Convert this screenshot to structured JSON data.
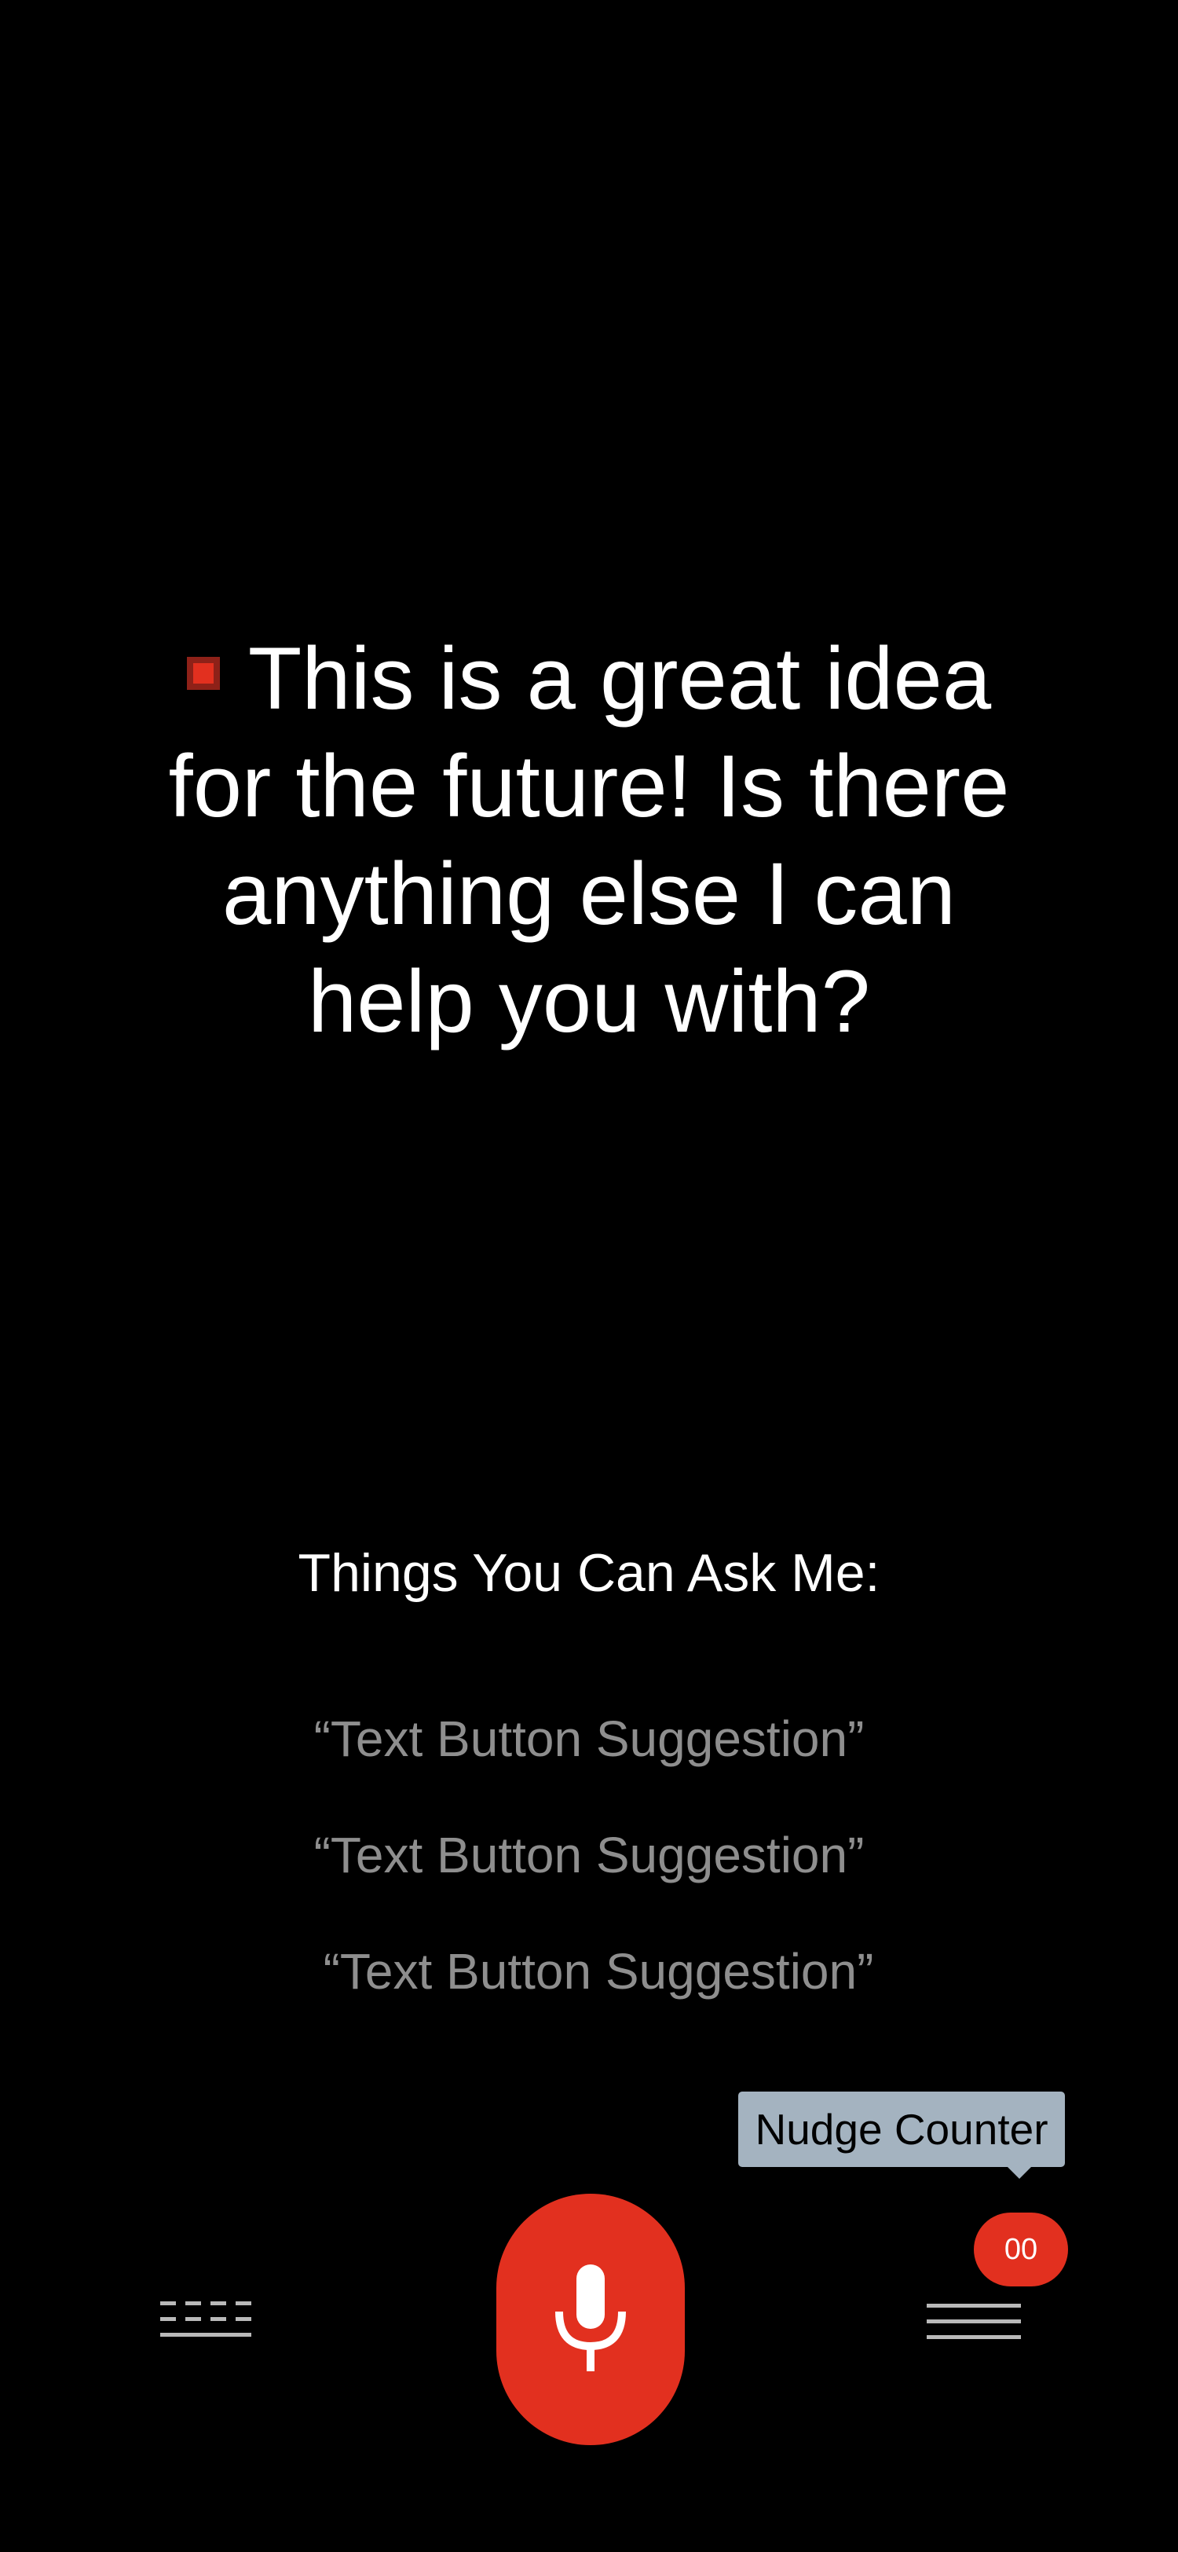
{
  "assistant": {
    "response_text": "This is a great idea for the future! Is there anything else I can help you with?",
    "indicator_icon": "red-square-indicator-icon"
  },
  "suggestions": {
    "title": "Things You Can Ask Me:",
    "items": [
      "“Text Button Suggestion”",
      "“Text Button Suggestion”",
      "“Text Button Suggestion”"
    ]
  },
  "nudge": {
    "tooltip_label": "Nudge Counter",
    "counter_value": "00"
  },
  "bottom_bar": {
    "keyboard_icon": "keyboard-icon",
    "mic_icon": "microphone-icon",
    "menu_icon": "menu-icon"
  },
  "colors": {
    "background": "#000000",
    "accent": "#e2301f",
    "suggestion_text": "#8e8e8e",
    "tooltip_bg": "#a4b3c0"
  }
}
